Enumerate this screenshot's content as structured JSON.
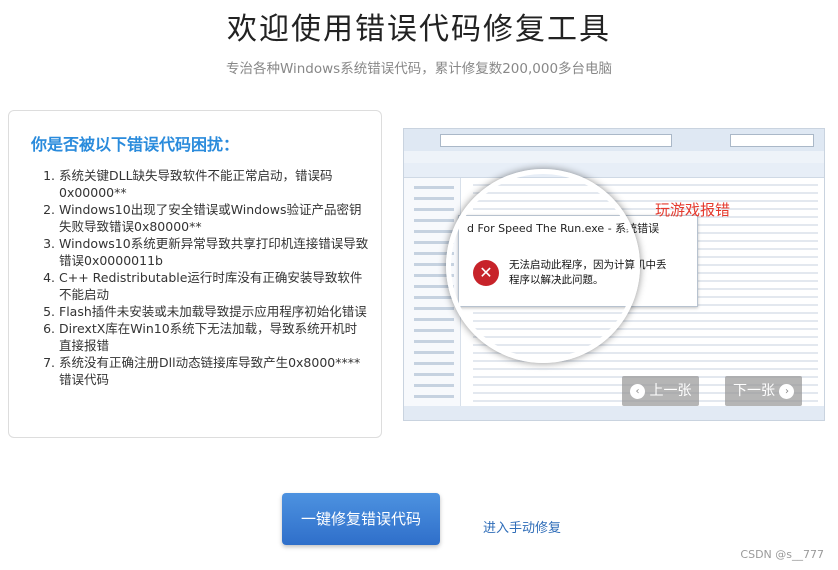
{
  "header": {
    "title": "欢迎使用错误代码修复工具",
    "subtitle": "专治各种Windows系统错误代码，累计修复数200,000多台电脑"
  },
  "issues": {
    "title": "你是否被以下错误代码困扰：",
    "items": [
      "系统关键DLL缺失导致软件不能正常启动，错误码0x00000**",
      "Windows10出现了安全错误或Windows验证产品密钥失败导致错误0x80000**",
      "Windows10系统更新异常导致共享打印机连接错误导致错误0x0000011b",
      "C++ Redistributable运行时库没有正确安装导致软件不能启动",
      "Flash插件未安装或未加载导致提示应用程序初始化错误",
      "DirextX库在Win10系统下无法加载，导致系统开机时直接报错",
      "系统没有正确注册Dll动态链接库导致产生0x8000****错误代码"
    ]
  },
  "slideshow": {
    "dialog_title": "d For Speed The Run.exe - 系统错误",
    "error_line1": "无法启动此程序，因为计算机中丢",
    "error_line2": "程序以解决此问题。",
    "caption": "玩游戏报错",
    "prev_label": "上一张",
    "next_label": "下一张"
  },
  "actions": {
    "fix_button": "一键修复错误代码",
    "manual_link": "进入手动修复"
  },
  "watermark": "CSDN @s__777"
}
